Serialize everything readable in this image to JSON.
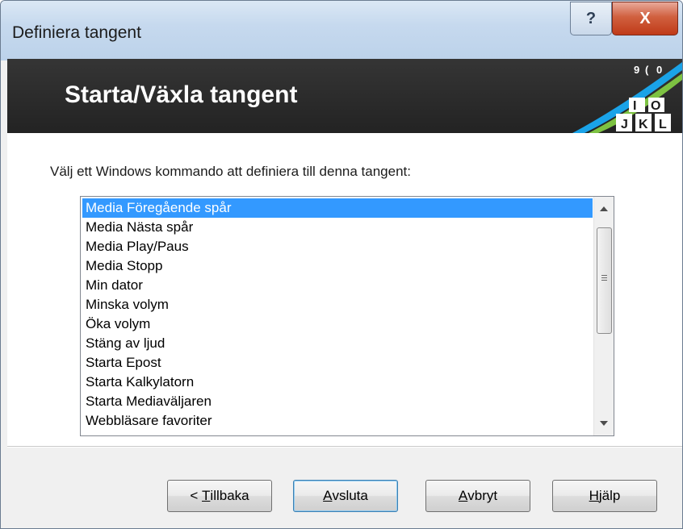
{
  "window": {
    "title": "Definiera tangent",
    "help_glyph": "?",
    "close_glyph": "X"
  },
  "banner": {
    "title": "Starta/Växla tangent",
    "keys": [
      "9",
      "(",
      "0",
      "I",
      "O",
      "J",
      "K",
      "L"
    ]
  },
  "content": {
    "prompt": "Välj ett Windows kommando att definiera till denna tangent:",
    "list": {
      "selected_index": 0,
      "items": [
        "Media Föregående spår",
        "Media Nästa spår",
        "Media Play/Paus",
        "Media Stopp",
        "Min dator",
        "Minska volym",
        "Öka volym",
        "Stäng av ljud",
        "Starta Epost",
        "Starta Kalkylatorn",
        "Starta Mediaväljaren",
        "Webbläsare favoriter"
      ]
    }
  },
  "buttons": {
    "back": {
      "prefix": "< ",
      "mnemonic": "T",
      "rest": "illbaka"
    },
    "finish": {
      "prefix": "",
      "mnemonic": "A",
      "rest": "vsluta"
    },
    "cancel": {
      "prefix": "",
      "mnemonic": "A",
      "rest": "vbryt"
    },
    "help": {
      "prefix": "",
      "mnemonic": "H",
      "rest": "jälp"
    }
  },
  "colors": {
    "selection": "#3399ff",
    "banner_bg": "#2b2b2b",
    "stripe_blue": "#1aa3e8",
    "stripe_green": "#7dc242"
  }
}
